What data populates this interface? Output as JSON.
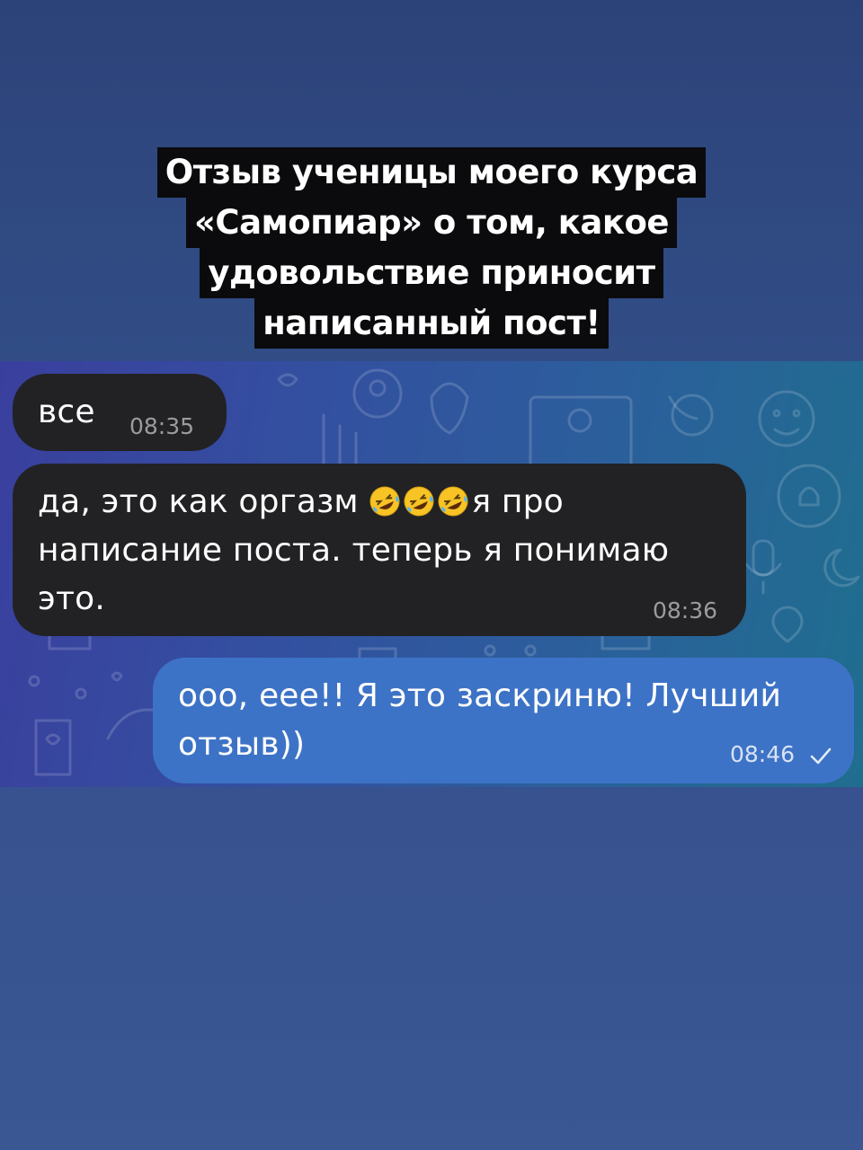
{
  "caption": {
    "lines": [
      "Отзыв ученицы моего курса",
      "«Самопиар» о том, какое",
      "удовольствие приносит",
      "написанный пост!"
    ]
  },
  "messages": [
    {
      "direction": "incoming",
      "text": "все",
      "time": "08:35"
    },
    {
      "direction": "incoming",
      "text_before_emoji": "да, это как оргазм ",
      "emoji": [
        "rolling-on-floor-laughing",
        "rolling-on-floor-laughing",
        "rolling-on-floor-laughing"
      ],
      "text_after_emoji": "я про написание поста. теперь я понимаю это.",
      "time": "08:36"
    },
    {
      "direction": "outgoing",
      "text": "ооо, еее!! Я это заскриню! Лучший отзыв))",
      "time": "08:46",
      "status_icon": "check-icon"
    }
  ],
  "colors": {
    "incoming_bubble": "#222224",
    "outgoing_bubble": "#3d73c6",
    "caption_bg": "#0b0b0d"
  }
}
